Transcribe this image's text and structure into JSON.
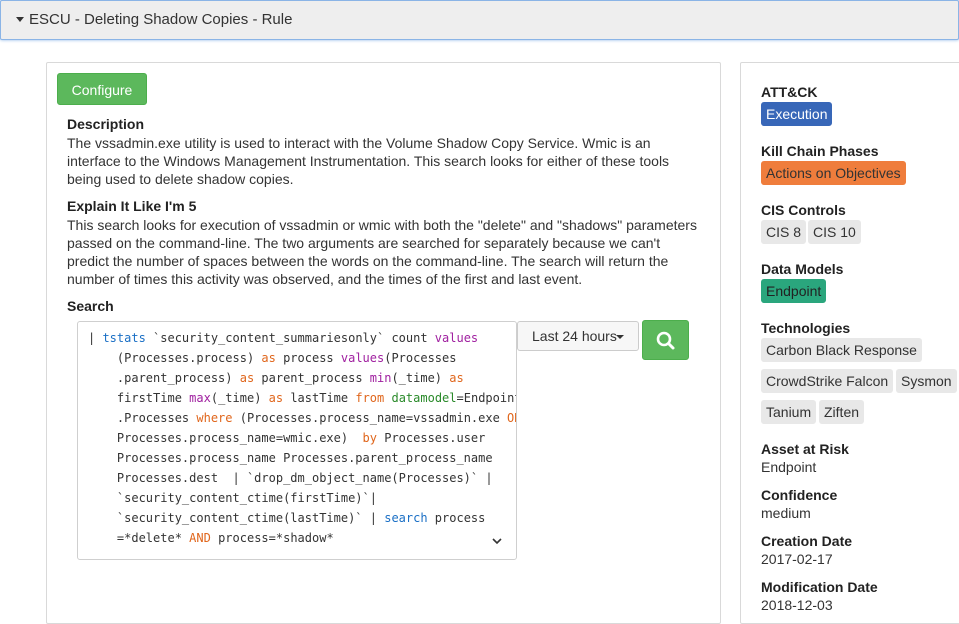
{
  "header": {
    "title": "ESCU - Deleting Shadow Copies - Rule"
  },
  "toolbar": {
    "configure_label": "Configure"
  },
  "description": {
    "heading": "Description",
    "lines": [
      "The vssadmin.exe utility is used to interact with the Volume Shadow Copy Service. Wmic is an",
      "interface to the Windows Management Instrumentation. This search looks for either of these tools",
      "being used to delete shadow copies."
    ]
  },
  "eli5": {
    "heading": "Explain It Like I'm 5",
    "lines": [
      "This search looks for execution of vssadmin or wmic with both the \"delete\" and \"shadows\" parameters",
      "passed on the command-line. The two arguments are searched for separately because we can't",
      "predict the number of spaces between the words on the command-line. The search will return the",
      "number of times this activity was observed, and the times of the first and last event."
    ]
  },
  "search": {
    "heading": "Search",
    "time_range": "Last 24 hours",
    "search_icon": "magnifier-icon",
    "code_lines": [
      [
        {
          "t": "| ",
          "c": ""
        },
        {
          "t": "tstats",
          "c": "kw-blue"
        },
        {
          "t": " `security_content_summariesonly` count ",
          "c": ""
        },
        {
          "t": "values",
          "c": "kw-purple"
        }
      ],
      [
        {
          "t": "    (Processes.process) ",
          "c": ""
        },
        {
          "t": "as",
          "c": "kw-orange"
        },
        {
          "t": " process ",
          "c": ""
        },
        {
          "t": "values",
          "c": "kw-purple"
        },
        {
          "t": "(Processes",
          "c": ""
        }
      ],
      [
        {
          "t": "    .parent_process) ",
          "c": ""
        },
        {
          "t": "as",
          "c": "kw-orange"
        },
        {
          "t": " parent_process ",
          "c": ""
        },
        {
          "t": "min",
          "c": "kw-purple"
        },
        {
          "t": "(_time) ",
          "c": ""
        },
        {
          "t": "as",
          "c": "kw-orange"
        }
      ],
      [
        {
          "t": "    firstTime ",
          "c": ""
        },
        {
          "t": "max",
          "c": "kw-purple"
        },
        {
          "t": "(_time) ",
          "c": ""
        },
        {
          "t": "as",
          "c": "kw-orange"
        },
        {
          "t": " lastTime ",
          "c": ""
        },
        {
          "t": "from",
          "c": "kw-orange"
        },
        {
          "t": " ",
          "c": ""
        },
        {
          "t": "datamodel",
          "c": "kw-green"
        },
        {
          "t": "=Endpoint",
          "c": ""
        }
      ],
      [
        {
          "t": "    .Processes ",
          "c": ""
        },
        {
          "t": "where",
          "c": "kw-orange"
        },
        {
          "t": " (Processes.process_name=vssadmin.exe ",
          "c": ""
        },
        {
          "t": "OR",
          "c": "kw-orange"
        }
      ],
      [
        {
          "t": "    Processes.process_name=wmic.exe)  ",
          "c": ""
        },
        {
          "t": "by",
          "c": "kw-orange"
        },
        {
          "t": " Processes.user",
          "c": ""
        }
      ],
      [
        {
          "t": "    Processes.process_name Processes.parent_process_name",
          "c": ""
        }
      ],
      [
        {
          "t": "    Processes.dest  | `drop_dm_object_name(Processes)` |",
          "c": ""
        }
      ],
      [
        {
          "t": "    `security_content_ctime(firstTime)`|",
          "c": ""
        }
      ],
      [
        {
          "t": "    `security_content_ctime(lastTime)` | ",
          "c": ""
        },
        {
          "t": "search",
          "c": "kw-blue"
        },
        {
          "t": " process",
          "c": ""
        }
      ],
      [
        {
          "t": "    =*delete* ",
          "c": ""
        },
        {
          "t": "AND",
          "c": "kw-orange"
        },
        {
          "t": " process=*shadow*",
          "c": ""
        }
      ]
    ]
  },
  "sidebar": {
    "attck": {
      "label": "ATT&CK",
      "tags": [
        "Execution"
      ]
    },
    "kill_chain": {
      "label": "Kill Chain Phases",
      "tags": [
        "Actions on Objectives"
      ]
    },
    "cis": {
      "label": "CIS Controls",
      "tags": [
        "CIS 8",
        "CIS 10"
      ]
    },
    "data_models": {
      "label": "Data Models",
      "tags": [
        "Endpoint"
      ]
    },
    "technologies": {
      "label": "Technologies",
      "tags": [
        "Carbon Black Response",
        "CrowdStrike Falcon",
        "Sysmon",
        "Tanium",
        "Ziften"
      ]
    },
    "asset": {
      "label": "Asset at Risk",
      "value": "Endpoint"
    },
    "confidence": {
      "label": "Confidence",
      "value": "medium"
    },
    "creation": {
      "label": "Creation Date",
      "value": "2017-02-17"
    },
    "modification": {
      "label": "Modification Date",
      "value": "2018-12-03"
    }
  },
  "colors": {
    "accent_green": "#5cb85c",
    "tag_blue": "#3867b8",
    "tag_orange": "#ef7d3c",
    "tag_green": "#2aa67d",
    "tag_gray": "#e8e8e8"
  }
}
